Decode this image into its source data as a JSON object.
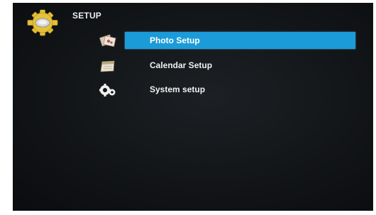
{
  "header": {
    "title": "SETUP",
    "icon": "gear-icon"
  },
  "menu": {
    "items": [
      {
        "label": "Photo Setup",
        "icon": "photos-icon",
        "selected": true
      },
      {
        "label": "Calendar Setup",
        "icon": "calendar-icon",
        "selected": false
      },
      {
        "label": "System setup",
        "icon": "system-gears-icon",
        "selected": false
      }
    ]
  },
  "colors": {
    "highlight": "#1b9bd8",
    "background": "#121518",
    "text": "#eef1f3",
    "gear": "#e7c43a"
  }
}
